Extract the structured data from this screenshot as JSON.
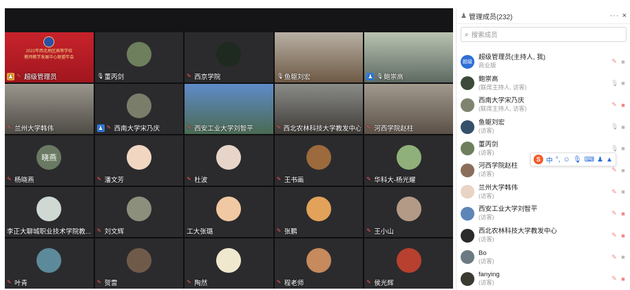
{
  "panel": {
    "title": "管理成员(232)",
    "more": "···",
    "close": "×",
    "search_placeholder": "搜索成员",
    "members": [
      {
        "name": "超级管理员(主持人, 我)",
        "sub": "商业版",
        "avatar": "超级"
      },
      {
        "name": "鲍崇高",
        "sub": "(联席主持人, 访客)",
        "avatar": ""
      },
      {
        "name": "西南大学宋乃庆",
        "sub": "(联席主持人, 访客)",
        "avatar": ""
      },
      {
        "name": "鱼躯刘宏",
        "sub": "(访客)",
        "avatar": ""
      },
      {
        "name": "董丙剑",
        "sub": "(访客)",
        "avatar": ""
      },
      {
        "name": "河西学院赵柱",
        "sub": "(访客)",
        "avatar": ""
      },
      {
        "name": "兰州大学韩伟",
        "sub": "(访客)",
        "avatar": ""
      },
      {
        "name": "西安工业大学刘智平",
        "sub": "(访客)",
        "avatar": ""
      },
      {
        "name": "西北农林科技大学教发中心",
        "sub": "(访客)",
        "avatar": ""
      },
      {
        "name": "Bo",
        "sub": "(访客)",
        "avatar": ""
      },
      {
        "name": "fanying",
        "sub": "(访客)",
        "avatar": ""
      }
    ]
  },
  "banner": {
    "line1": "2022年西北地区高等学校",
    "line2": "教师教学发展中心联盟年会"
  },
  "tiles": [
    {
      "name": "超级管理员",
      "kind": "banner"
    },
    {
      "name": "董丙剑"
    },
    {
      "name": "西京学院"
    },
    {
      "name": "鱼躯刘宏",
      "kind": "vid"
    },
    {
      "name": "鲍崇高",
      "kind": "vid"
    },
    {
      "name": "兰州大学韩伟",
      "kind": "vid"
    },
    {
      "name": "西南大学宋乃庆"
    },
    {
      "name": "西安工业大学刘智平",
      "kind": "vid"
    },
    {
      "name": "西北农林科技大学教发中心",
      "kind": "vid"
    },
    {
      "name": "河西学院赵柱",
      "kind": "vid"
    },
    {
      "name": "杨晓燕",
      "avatar_text": "晓燕"
    },
    {
      "name": "潘文芳"
    },
    {
      "name": "杜波"
    },
    {
      "name": "王书画"
    },
    {
      "name": "华科大-杨光耀"
    },
    {
      "name": "李正大聊城职业技术学院教..."
    },
    {
      "name": "刘文辉"
    },
    {
      "name": "工大张璐"
    },
    {
      "name": "张鹏"
    },
    {
      "name": "王小山"
    },
    {
      "name": "叶青"
    },
    {
      "name": "贺雷"
    },
    {
      "name": "陶然"
    },
    {
      "name": "程老师"
    },
    {
      "name": "侯光辉"
    }
  ],
  "ime": {
    "label1": "中",
    "label2": "°,"
  }
}
